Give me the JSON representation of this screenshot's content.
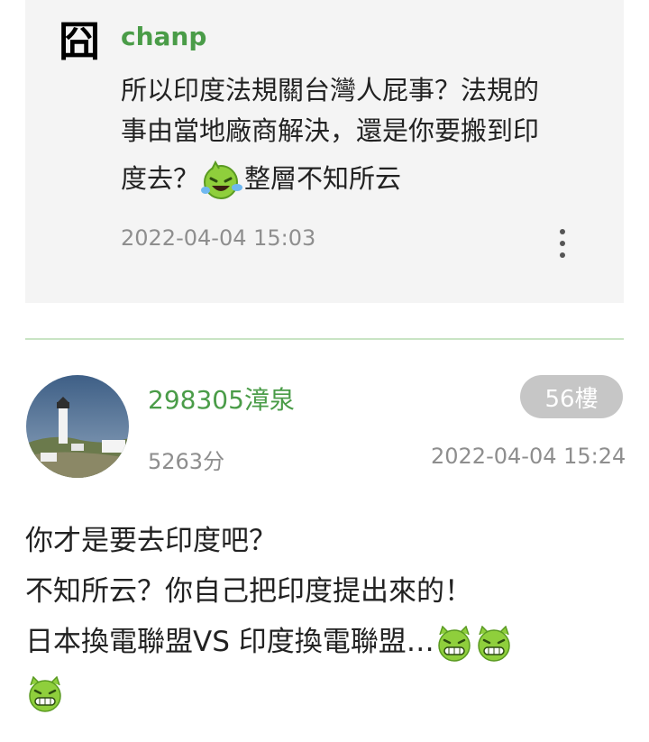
{
  "reply": {
    "avatar_glyph": "囧",
    "author": "chanp",
    "lines": [
      "所以印度法規關台灣人屁事？法規的",
      "事由當地廠商解決，還是你要搬到印"
    ],
    "line3_before": "度去？",
    "line3_after": "整層不知所云",
    "timestamp": "2022-04-04 15:03",
    "emoji_icon": "laughing-tears-emoji"
  },
  "post": {
    "author": "298305漳泉",
    "floor": "56樓",
    "score": "5263分",
    "timestamp": "2022-04-04 15:24",
    "lines": [
      "你才是要去印度吧？",
      "不知所云？你自己把印度提出來的！"
    ],
    "line3": "日本換電聯盟VS 印度換電聯盟…",
    "emoji_icon": "grinning-devil-emoji",
    "emoji_count": 3
  },
  "colors": {
    "author_green": "#4a9c48",
    "meta_gray": "#8e8e8e",
    "card_bg": "#f4f4f4",
    "divider": "#c9e4c4",
    "badge_bg": "#c6c6c6"
  }
}
